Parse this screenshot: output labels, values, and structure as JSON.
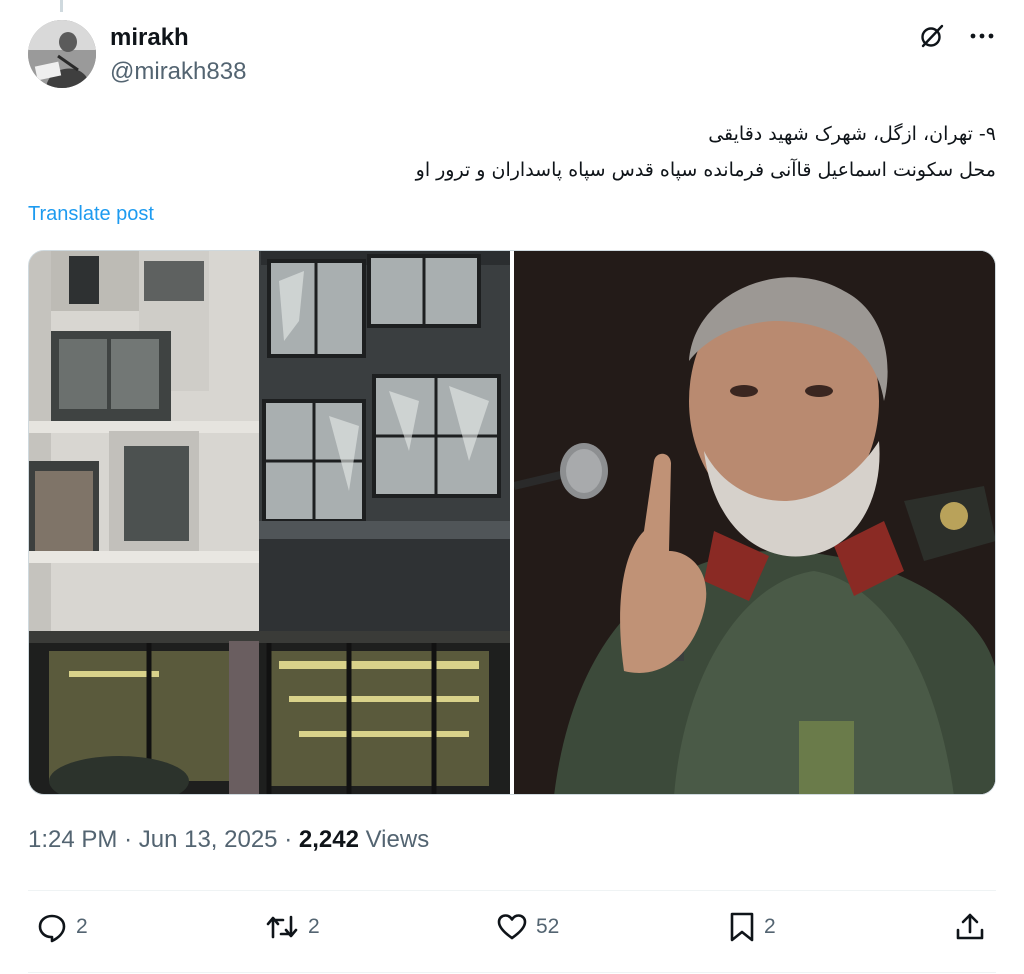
{
  "author": {
    "display_name": "mirakh",
    "handle": "@mirakh838"
  },
  "tweet": {
    "lines": [
      "۹- تهران، ازگل، شهرک شهید دقایقی",
      "محل سکونت اسماعیل قاآنی فرمانده سپاه قدس سپاه پاسداران و ترور او"
    ],
    "translate_label": "Translate post"
  },
  "meta": {
    "time": "1:24 PM",
    "separator": "·",
    "date": "Jun 13, 2025",
    "views_count": "2,242",
    "views_label": "Views"
  },
  "actions": {
    "replies": "2",
    "reposts": "2",
    "likes": "52",
    "bookmarks": "2"
  },
  "icons": {
    "header": [
      "grok-icon",
      "more-icon"
    ],
    "actions": [
      "reply-icon",
      "repost-icon",
      "like-icon",
      "bookmark-icon",
      "share-icon"
    ]
  },
  "colors": {
    "link": "#1d9bf0",
    "secondary_text": "#536471",
    "primary_text": "#0f1419"
  }
}
